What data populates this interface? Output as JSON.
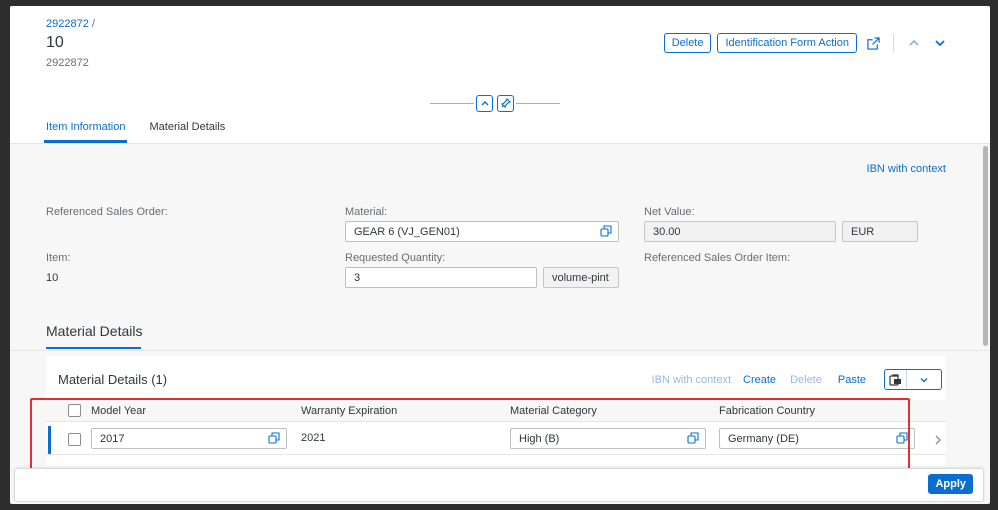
{
  "header": {
    "breadcrumb": "2922872",
    "breadcrumb_sep": "/",
    "title": "10",
    "subtitle": "2922872",
    "delete_label": "Delete",
    "identification_label": "Identification Form Action"
  },
  "tabs": [
    {
      "label": "Item Information",
      "active": true
    },
    {
      "label": "Material Details",
      "active": false
    }
  ],
  "item_info": {
    "ibn_link": "IBN with context",
    "referenced_sales_order_label": "Referenced Sales Order:",
    "material_label": "Material:",
    "material_value": "GEAR 6 (VJ_GEN01)",
    "net_value_label": "Net Value:",
    "net_value": "30.00",
    "currency": "EUR",
    "item_label": "Item:",
    "item_value": "10",
    "requested_quantity_label": "Requested Quantity:",
    "requested_quantity_value": "3",
    "unit": "volume-pint",
    "ref_sales_order_item_label": "Referenced Sales Order Item:"
  },
  "material_details": {
    "section_title": "Material Details",
    "table_title": "Material Details (1)",
    "tools": {
      "ibn": "IBN with context",
      "create": "Create",
      "delete": "Delete",
      "paste": "Paste"
    },
    "columns": [
      "Model Year",
      "Warranty Expiration",
      "Material Category",
      "Fabrication Country"
    ],
    "rows": [
      {
        "model_year": "2017",
        "warranty_expiration": "2021",
        "material_category": "High (B)",
        "fabrication_country": "Germany (DE)"
      }
    ]
  },
  "footer": {
    "apply_label": "Apply"
  },
  "colors": {
    "accent": "#0a6ed1",
    "highlight": "#e03131"
  }
}
